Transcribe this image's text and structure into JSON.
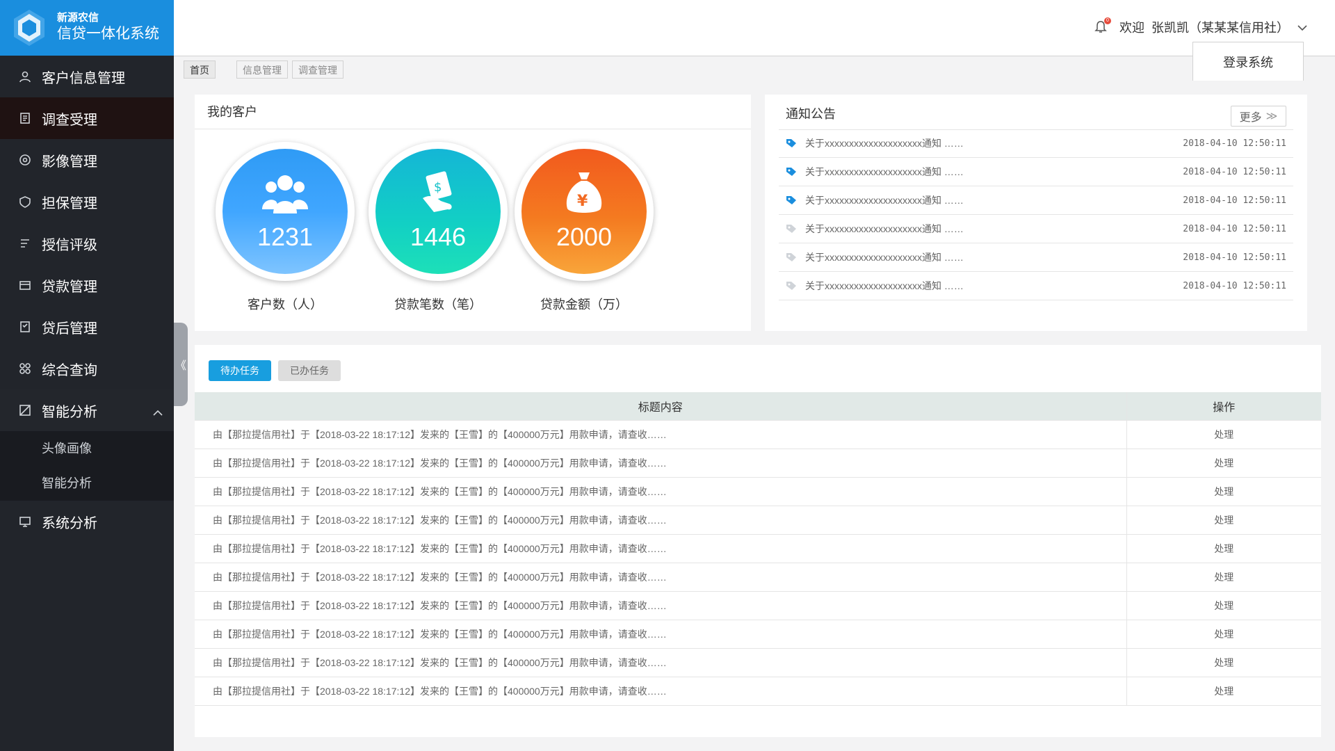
{
  "logo": {
    "line1": "新源农信",
    "line2": "信贷一体化系统"
  },
  "sidebar": {
    "items": [
      {
        "label": "客户信息管理",
        "icon": "user-icon"
      },
      {
        "label": "调查受理",
        "icon": "survey-icon"
      },
      {
        "label": "影像管理",
        "icon": "image-icon"
      },
      {
        "label": "担保管理",
        "icon": "guarantee-icon"
      },
      {
        "label": "授信评级",
        "icon": "rating-icon"
      },
      {
        "label": "贷款管理",
        "icon": "loan-icon"
      },
      {
        "label": "贷后管理",
        "icon": "post-loan-icon"
      },
      {
        "label": "综合查询",
        "icon": "query-icon"
      },
      {
        "label": "智能分析",
        "icon": "analysis-icon"
      },
      {
        "label": "系统分析",
        "icon": "system-icon"
      }
    ],
    "sub_items": [
      "头像画像",
      "智能分析"
    ],
    "active_index": 1
  },
  "header": {
    "welcome": "欢迎",
    "user": "张凯凯（某某某信用社）",
    "bell_count": "0",
    "login_tab": "登录系统"
  },
  "tabs": [
    "首页",
    "信息管理",
    "调查管理"
  ],
  "customers": {
    "title": "我的客户",
    "stats": [
      {
        "value": "1231",
        "label": "客户数（人）",
        "color": "#2f8ff0"
      },
      {
        "value": "1446",
        "label": "贷款笔数（笔）",
        "color": "#15c2c9"
      },
      {
        "value": "2000",
        "label": "贷款金额（万）",
        "color": "#f26a22"
      }
    ]
  },
  "notices": {
    "title": "通知公告",
    "more": "更多",
    "rows": [
      {
        "title": "关于xxxxxxxxxxxxxxxxxxxx通知 ……",
        "date": "2018-04-10 12:50:11",
        "read": false
      },
      {
        "title": "关于xxxxxxxxxxxxxxxxxxxx通知 ……",
        "date": "2018-04-10 12:50:11",
        "read": false
      },
      {
        "title": "关于xxxxxxxxxxxxxxxxxxxx通知 ……",
        "date": "2018-04-10 12:50:11",
        "read": false
      },
      {
        "title": "关于xxxxxxxxxxxxxxxxxxxx通知 ……",
        "date": "2018-04-10 12:50:11",
        "read": true
      },
      {
        "title": "关于xxxxxxxxxxxxxxxxxxxx通知 ……",
        "date": "2018-04-10 12:50:11",
        "read": true
      },
      {
        "title": "关于xxxxxxxxxxxxxxxxxxxx通知 ……",
        "date": "2018-04-10 12:50:11",
        "read": true
      }
    ]
  },
  "tasks": {
    "tab_todo": "待办任务",
    "tab_done": "已办任务",
    "col_title": "标题内容",
    "col_action": "操作",
    "rows": [
      {
        "text": "由【那拉提信用社】于【2018-03-22 18:17:12】发来的【王雪】的【400000万元】用款申请，请查收……",
        "action": "处理"
      },
      {
        "text": "由【那拉提信用社】于【2018-03-22 18:17:12】发来的【王雪】的【400000万元】用款申请，请查收……",
        "action": "处理"
      },
      {
        "text": "由【那拉提信用社】于【2018-03-22 18:17:12】发来的【王雪】的【400000万元】用款申请，请查收……",
        "action": "处理"
      },
      {
        "text": "由【那拉提信用社】于【2018-03-22 18:17:12】发来的【王雪】的【400000万元】用款申请，请查收……",
        "action": "处理"
      },
      {
        "text": "由【那拉提信用社】于【2018-03-22 18:17:12】发来的【王雪】的【400000万元】用款申请，请查收……",
        "action": "处理"
      },
      {
        "text": "由【那拉提信用社】于【2018-03-22 18:17:12】发来的【王雪】的【400000万元】用款申请，请查收……",
        "action": "处理"
      },
      {
        "text": "由【那拉提信用社】于【2018-03-22 18:17:12】发来的【王雪】的【400000万元】用款申请，请查收……",
        "action": "处理"
      },
      {
        "text": "由【那拉提信用社】于【2018-03-22 18:17:12】发来的【王雪】的【400000万元】用款申请，请查收……",
        "action": "处理"
      },
      {
        "text": "由【那拉提信用社】于【2018-03-22 18:17:12】发来的【王雪】的【400000万元】用款申请，请查收……",
        "action": "处理"
      },
      {
        "text": "由【那拉提信用社】于【2018-03-22 18:17:12】发来的【王雪】的【400000万元】用款申请，请查收……",
        "action": "处理"
      }
    ]
  },
  "colors": {
    "accent": "#189edf",
    "sidebar": "#22252b",
    "logo_bg": "#1a8ede"
  }
}
